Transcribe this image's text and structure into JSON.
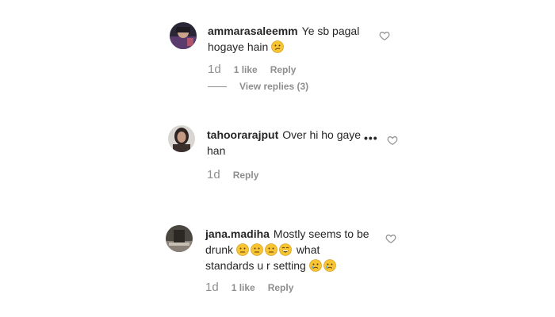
{
  "comments": [
    {
      "username": "ammarasaleemm",
      "text_line1": "Ye sb pagal",
      "text_line2": "hogaye hain",
      "time": "1d",
      "likes": "1 like",
      "reply": "Reply",
      "view_replies": "View replies (3)"
    },
    {
      "username": "tahoorarajput",
      "text_line1": "Over hi ho gaye",
      "text_line2": "han",
      "time": "1d",
      "reply": "Reply",
      "more": "•••"
    },
    {
      "username": "jana.madiha",
      "text_line1": "Mostly seems to be",
      "text_line2": "drunk",
      "text_line2_after": "what",
      "text_line3": "standards u r setting",
      "time": "1d",
      "likes": "1 like",
      "reply": "Reply"
    }
  ],
  "colors": {
    "text": "#262626",
    "secondary": "#8e8e8e",
    "emoji_yellow": "#f7c531"
  },
  "icons": [
    "heart-icon",
    "more-options-icon",
    "neutral-face-emoji",
    "grinning-face-emoji",
    "confused-face-emoji",
    "sad-face-emoji"
  ]
}
